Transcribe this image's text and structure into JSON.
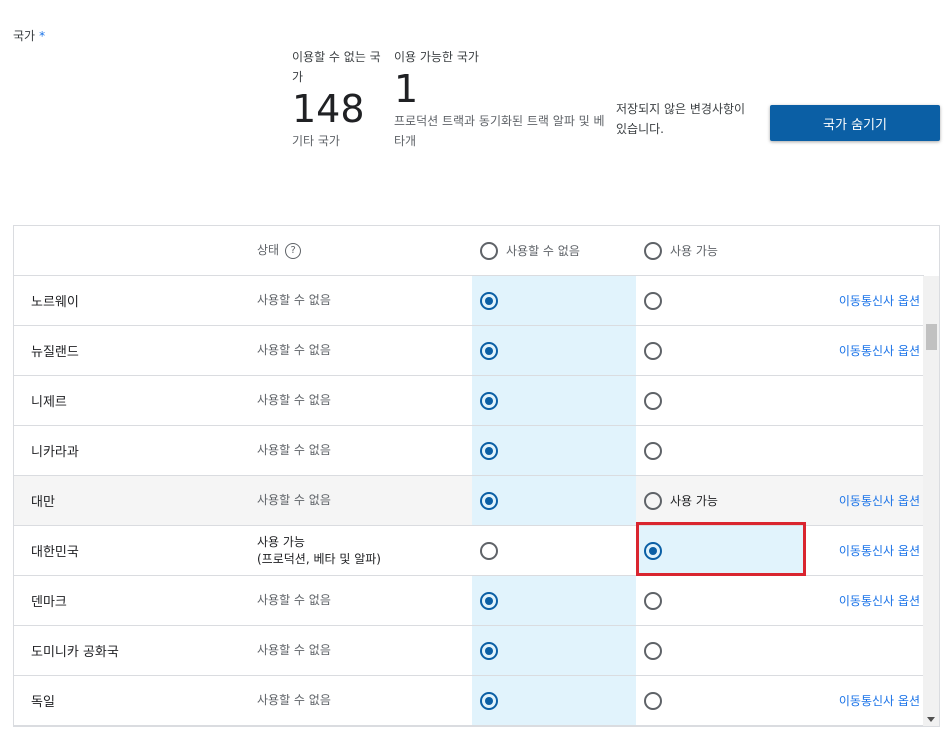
{
  "field": {
    "label": "국가",
    "required_mark": "*"
  },
  "stats": {
    "unavailable": {
      "caption": "이용할 수 없는 국가",
      "count": "148",
      "sub": "기타 국가"
    },
    "available": {
      "caption": "이용 가능한 국가",
      "count": "1",
      "sub": "프로덕션 트랙과 동기화된 트랙 알파 및 베타개"
    }
  },
  "unsaved_message": "저장되지 않은 변경사항이 있습니다.",
  "hide_button_label": "국가 숨기기",
  "table": {
    "header": {
      "status": "상태",
      "help_icon": "?",
      "unavailable": "사용할 수 없음",
      "available": "사용 가능"
    },
    "rows": [
      {
        "name": "노르웨이",
        "status": "사용할 수 없음",
        "selected": "unavailable",
        "link": "이동통신사 옵션"
      },
      {
        "name": "뉴질랜드",
        "status": "사용할 수 없음",
        "selected": "unavailable",
        "link": "이동통신사 옵션"
      },
      {
        "name": "니제르",
        "status": "사용할 수 없음",
        "selected": "unavailable",
        "link": ""
      },
      {
        "name": "니카라과",
        "status": "사용할 수 없음",
        "selected": "unavailable",
        "link": ""
      },
      {
        "name": "대만",
        "status": "사용할 수 없음",
        "selected": "unavailable",
        "avail_label": "사용 가능",
        "link": "이동통신사 옵션"
      },
      {
        "name": "대한민국",
        "status": "사용 가능",
        "status_line2": "(프로덕션, 베타 및 알파)",
        "selected": "available",
        "link": "이동통신사 옵션"
      },
      {
        "name": "덴마크",
        "status": "사용할 수 없음",
        "selected": "unavailable",
        "link": "이동통신사 옵션"
      },
      {
        "name": "도미니카 공화국",
        "status": "사용할 수 없음",
        "selected": "unavailable",
        "link": ""
      },
      {
        "name": "독일",
        "status": "사용할 수 없음",
        "selected": "unavailable",
        "link": "이동통신사 옵션"
      }
    ]
  },
  "colors": {
    "accent": "#0b5fa5",
    "tint": "#e1f3fc",
    "link": "#1a73e8",
    "focus": "#d9252f"
  }
}
